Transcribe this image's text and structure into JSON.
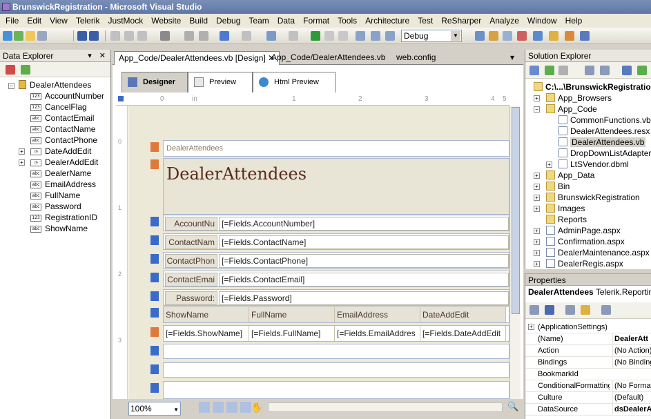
{
  "window": {
    "title": "BrunswickRegistration - Microsoft Visual Studio"
  },
  "menu": [
    "File",
    "Edit",
    "View",
    "Telerik",
    "JustMock",
    "Website",
    "Build",
    "Debug",
    "Team",
    "Data",
    "Format",
    "Tools",
    "Architecture",
    "Test",
    "ReSharper",
    "Analyze",
    "Window",
    "Help"
  ],
  "toolbar": {
    "config_value": "Debug"
  },
  "data_explorer": {
    "title": "Data Explorer",
    "root": "DealerAttendees",
    "fields": [
      {
        "name": "AccountNumber",
        "type_icon": "123",
        "expandable": false
      },
      {
        "name": "CancelFlag",
        "type_icon": "123",
        "expandable": false
      },
      {
        "name": "ContactEmail",
        "type_icon": "abc",
        "expandable": false
      },
      {
        "name": "ContactName",
        "type_icon": "abc",
        "expandable": false
      },
      {
        "name": "ContactPhone",
        "type_icon": "abc",
        "expandable": false
      },
      {
        "name": "DateAddEdit",
        "type_icon": "clock",
        "expandable": true
      },
      {
        "name": "DealerAddEdit",
        "type_icon": "clock",
        "expandable": true
      },
      {
        "name": "DealerName",
        "type_icon": "abc",
        "expandable": false
      },
      {
        "name": "EmailAddress",
        "type_icon": "abc",
        "expandable": false
      },
      {
        "name": "FullName",
        "type_icon": "abc",
        "expandable": false
      },
      {
        "name": "Password",
        "type_icon": "abc",
        "expandable": false
      },
      {
        "name": "RegistrationID",
        "type_icon": "123",
        "expandable": false
      },
      {
        "name": "ShowName",
        "type_icon": "abc",
        "expandable": false
      }
    ]
  },
  "doc_tabs": [
    "App_Code/DealerAttendees.vb [Design]",
    "App_Code/DealerAttendees.vb",
    "web.config"
  ],
  "view_tabs": [
    "Designer",
    "Preview",
    "Html Preview"
  ],
  "ruler": {
    "marks": [
      "0",
      "in",
      "1",
      "2",
      "3",
      "4",
      "5"
    ],
    "side_marks": [
      "0",
      "1",
      "2",
      "3"
    ]
  },
  "report": {
    "page_header_text": "DealerAttendees",
    "title": "DealerAttendees",
    "rows": [
      {
        "label": "AccountNu",
        "field": "[=Fields.AccountNumber]"
      },
      {
        "label": "ContactNam",
        "field": "[=Fields.ContactName]"
      },
      {
        "label": "ContactPhon",
        "field": "[=Fields.ContactPhone]"
      },
      {
        "label": "ContactEmai",
        "field": "[=Fields.ContactEmail]"
      },
      {
        "label": "Password:",
        "field": "[=Fields.Password]"
      }
    ],
    "table_headers": [
      "ShowName",
      "FullName",
      "EmailAddress",
      "DateAddEdit"
    ],
    "table_cells": [
      "[=Fields.ShowName]",
      "[=Fields.FullName]",
      "[=Fields.EmailAddres",
      "[=Fields.DateAddEdit"
    ]
  },
  "zoom": "100%",
  "solution_explorer": {
    "title": "Solution Explorer",
    "items": [
      {
        "label": "C:\\...\\BrunswickRegistration",
        "kind": "project",
        "level": 0,
        "bold": true
      },
      {
        "label": "App_Browsers",
        "kind": "folder",
        "level": 1,
        "exp": "+"
      },
      {
        "label": "App_Code",
        "kind": "folder",
        "level": 1,
        "exp": "-"
      },
      {
        "label": "CommonFunctions.vb",
        "kind": "file",
        "level": 2
      },
      {
        "label": "DealerAttendees.resx",
        "kind": "file",
        "level": 2
      },
      {
        "label": "DealerAttendees.vb",
        "kind": "file",
        "level": 2,
        "selected": true
      },
      {
        "label": "DropDownListAdapter.v",
        "kind": "file",
        "level": 2
      },
      {
        "label": "LtSVendor.dbml",
        "kind": "file",
        "level": 2,
        "exp": "+"
      },
      {
        "label": "App_Data",
        "kind": "folder",
        "level": 1,
        "exp": "+"
      },
      {
        "label": "Bin",
        "kind": "folder",
        "level": 1,
        "exp": "+"
      },
      {
        "label": "BrunswickRegistration",
        "kind": "folder",
        "level": 1,
        "exp": "+"
      },
      {
        "label": "Images",
        "kind": "folder",
        "level": 1,
        "exp": "+"
      },
      {
        "label": "Reports",
        "kind": "folder",
        "level": 1
      },
      {
        "label": "AdminPage.aspx",
        "kind": "file",
        "level": 1,
        "exp": "+"
      },
      {
        "label": "Confirmation.aspx",
        "kind": "file",
        "level": 1,
        "exp": "+"
      },
      {
        "label": "DealerMaintenance.aspx",
        "kind": "file",
        "level": 1,
        "exp": "+"
      },
      {
        "label": "DealerRegis.aspx",
        "kind": "file",
        "level": 1,
        "exp": "+"
      }
    ]
  },
  "properties": {
    "title": "Properties",
    "object_name": "DealerAttendees",
    "object_type": "Telerik.Reporting",
    "rows": [
      {
        "name": "(ApplicationSettings)",
        "value": "",
        "group": true
      },
      {
        "name": "(Name)",
        "value": "DealerAtt",
        "bold": true
      },
      {
        "name": "Action",
        "value": "(No Action)"
      },
      {
        "name": "Bindings",
        "value": "(No Bindings"
      },
      {
        "name": "BookmarkId",
        "value": ""
      },
      {
        "name": "ConditionalFormatting",
        "value": "(No Format"
      },
      {
        "name": "Culture",
        "value": "(Default)"
      },
      {
        "name": "DataSource",
        "value": "dsDealerA",
        "bold": true
      }
    ]
  }
}
